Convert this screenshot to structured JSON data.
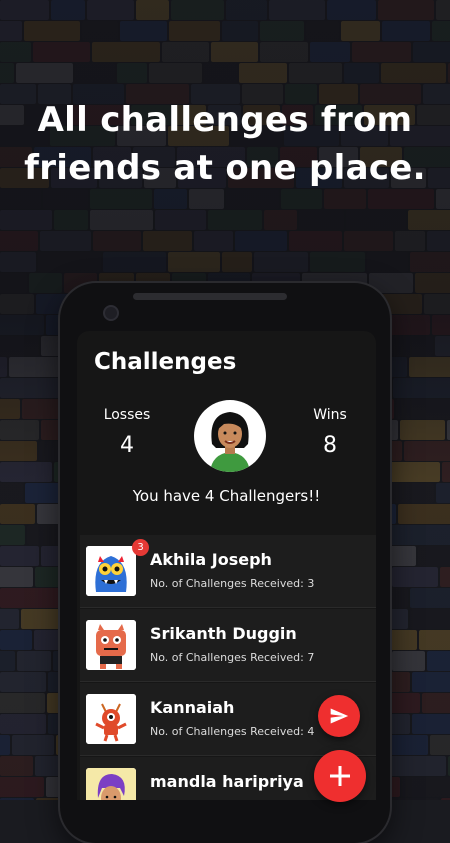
{
  "headline": {
    "line1": "All challenges from",
    "line2": "friends at one place."
  },
  "screen": {
    "title": "Challenges",
    "losses": {
      "label": "Losses",
      "value": "4"
    },
    "wins": {
      "label": "Wins",
      "value": "8"
    },
    "challengers_text": "You have 4 Challengers!!"
  },
  "challenges": [
    {
      "name": "Akhila Joseph",
      "received": "No. of Challenges Received: 3",
      "badge": "3",
      "avatar": "blue-monster-icon"
    },
    {
      "name": "Srikanth Duggin",
      "received": "No. of Challenges Received: 7",
      "avatar": "red-monster-icon"
    },
    {
      "name": "Kannaiah",
      "received": "No. of Challenges Received: 4",
      "avatar": "red-imp-icon"
    },
    {
      "name": "mandla haripriya",
      "received": "",
      "avatar": "purple-hair-girl-icon"
    }
  ],
  "colors": {
    "accent": "#ef2f2f",
    "card": "#1d1d1d",
    "screen": "#161616"
  }
}
